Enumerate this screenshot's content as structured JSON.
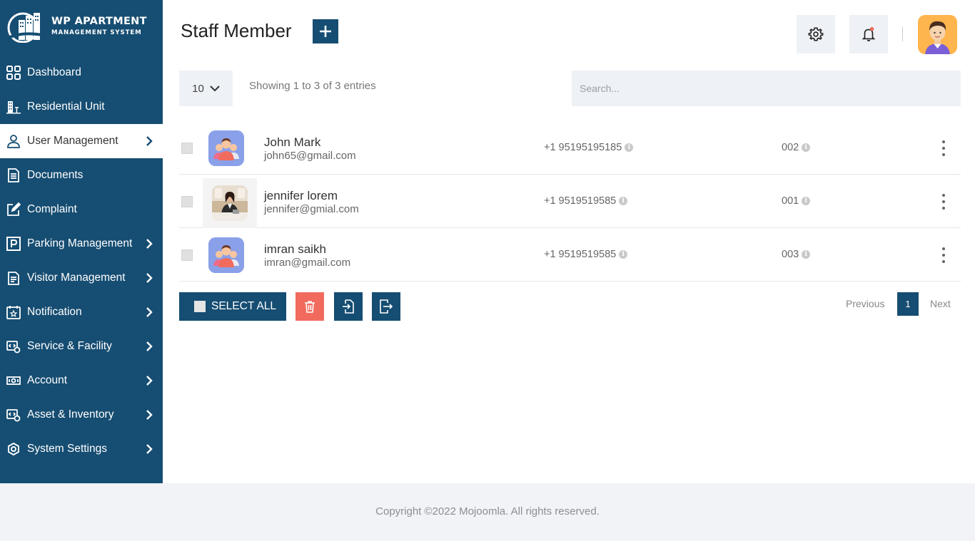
{
  "brand": {
    "title": "WP APARTMENT",
    "subtitle": "MANAGEMENT SYSTEM"
  },
  "sidebar": {
    "items": [
      {
        "label": "Dashboard",
        "icon": "dashboard-grid-icon",
        "has_chevron": false,
        "active": false
      },
      {
        "label": "Residential Unit",
        "icon": "building-icon",
        "has_chevron": false,
        "active": false
      },
      {
        "label": "User Management",
        "icon": "user-icon",
        "has_chevron": true,
        "active": true
      },
      {
        "label": "Documents",
        "icon": "document-icon",
        "has_chevron": false,
        "active": false
      },
      {
        "label": "Complaint",
        "icon": "edit-icon",
        "has_chevron": false,
        "active": false
      },
      {
        "label": "Parking Management",
        "icon": "parking-icon",
        "has_chevron": true,
        "active": false
      },
      {
        "label": "Visitor Management",
        "icon": "clipboard-icon",
        "has_chevron": true,
        "active": false
      },
      {
        "label": "Notification",
        "icon": "calendar-star-icon",
        "has_chevron": true,
        "active": false
      },
      {
        "label": "Service & Facility",
        "icon": "service-icon",
        "has_chevron": true,
        "active": false
      },
      {
        "label": "Account",
        "icon": "money-icon",
        "has_chevron": true,
        "active": false
      },
      {
        "label": "Asset & Inventory",
        "icon": "asset-icon",
        "has_chevron": true,
        "active": false
      },
      {
        "label": "System Settings",
        "icon": "settings-eye-icon",
        "has_chevron": true,
        "active": false
      }
    ]
  },
  "header": {
    "title": "Staff Member"
  },
  "controls": {
    "page_size": "10",
    "showing": "Showing 1 to 3 of 3 entries",
    "search_placeholder": "Search..."
  },
  "table": {
    "rows": [
      {
        "name": "John Mark",
        "email": "john65@gmail.com",
        "phone": "+1 95195195185",
        "code": "002",
        "avatar": "group-avatar"
      },
      {
        "name": "jennifer lorem",
        "email": "jennifer@gmial.com",
        "phone": "+1 9519519585",
        "code": "001",
        "avatar": "photo-avatar"
      },
      {
        "name": "imran saikh",
        "email": "imran@gmail.com",
        "phone": "+1 9519519585",
        "code": "003",
        "avatar": "group-avatar"
      }
    ]
  },
  "actions": {
    "select_all": "SELECT ALL"
  },
  "pagination": {
    "previous": "Previous",
    "current": "1",
    "next": "Next"
  },
  "footer": {
    "copyright": "Copyright ©2022 Mojoomla. All rights reserved."
  },
  "colors": {
    "primary": "#164d72",
    "danger": "#f06b5e",
    "light_bg": "#eef1f5",
    "avatar_bg": "#8aa0e8",
    "profile_bg": "#ffb54d"
  }
}
